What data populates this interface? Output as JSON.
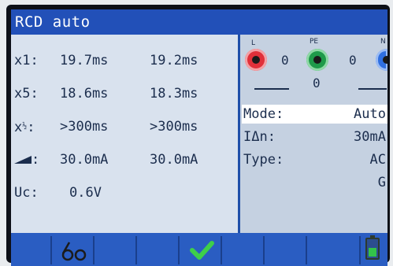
{
  "title": "RCD auto",
  "results": [
    {
      "label": "x1:",
      "v1": "19.7ms",
      "v2": "19.2ms"
    },
    {
      "label": "x5:",
      "v1": "18.6ms",
      "v2": "18.3ms"
    },
    {
      "label": "x",
      "fraction": "1/2",
      "label_suffix": ":",
      "v1": ">300ms",
      "v2": ">300ms"
    },
    {
      "label": ":",
      "icon": "ramp-icon",
      "v1": "30.0mA",
      "v2": "30.0mA"
    }
  ],
  "uc": {
    "label": "Uc:",
    "value": "0.6V"
  },
  "terminals": {
    "L": {
      "label": "L",
      "value": "0",
      "color": "#e0303a"
    },
    "PE": {
      "label": "PE",
      "value": "0",
      "bottom_value": "0",
      "color": "#1f9a4a"
    },
    "N": {
      "label": "N",
      "value": "0",
      "color": "#2f6fe0"
    }
  },
  "params": [
    {
      "key": "Mode:",
      "value": "Auto",
      "selected": true
    },
    {
      "key": "IΔn:",
      "value": "30mA"
    },
    {
      "key": "Type:",
      "value": "AC"
    },
    {
      "key": "",
      "value": "G"
    }
  ],
  "bottom_bar": {
    "icons": [
      "empty",
      "glasses-icon",
      "empty",
      "empty",
      "check-icon",
      "empty",
      "empty",
      "empty",
      "battery-icon"
    ],
    "battery_level": 0.45,
    "check_color": "#3ecf4a"
  }
}
